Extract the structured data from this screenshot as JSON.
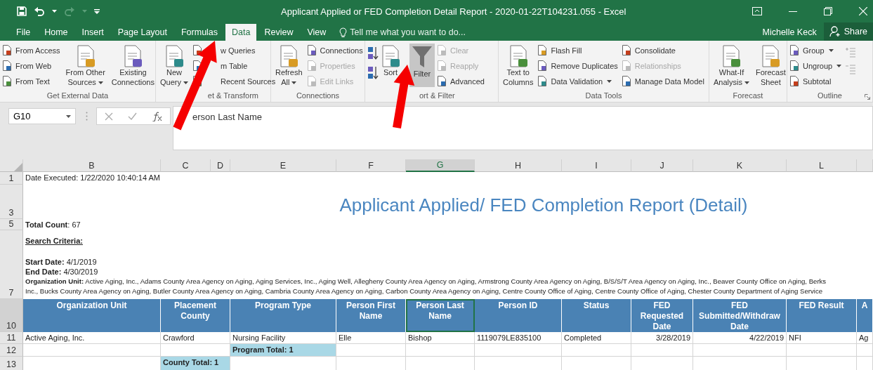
{
  "window": {
    "title": "Applicant Applied or FED Completion Detail Report - 2020-01-22T104231.055 - Excel",
    "user": "Michelle Keck",
    "share": "Share"
  },
  "tabs": [
    {
      "label": "File",
      "selected": false
    },
    {
      "label": "Home",
      "selected": false
    },
    {
      "label": "Insert",
      "selected": false
    },
    {
      "label": "Page Layout",
      "selected": false
    },
    {
      "label": "Formulas",
      "selected": false
    },
    {
      "label": "Data",
      "selected": true
    },
    {
      "label": "Review",
      "selected": false
    },
    {
      "label": "View",
      "selected": false
    }
  ],
  "tell_me": {
    "placeholder": "Tell me what you want to do..."
  },
  "ribbon_groups": [
    {
      "label": "Get External Data",
      "items": [
        {
          "kind": "stack",
          "items": [
            {
              "label": "From Access",
              "disabled": false
            },
            {
              "label": "From Web",
              "disabled": false
            },
            {
              "label": "From Text",
              "disabled": false
            }
          ]
        },
        {
          "kind": "large",
          "lines": [
            "From Other",
            "Sources"
          ],
          "dropdown": true,
          "selected": false
        },
        {
          "kind": "large",
          "lines": [
            "Existing",
            "Connections"
          ],
          "dropdown": false,
          "selected": false
        }
      ]
    },
    {
      "label": "et & Transform",
      "items": [
        {
          "kind": "large",
          "lines": [
            "New",
            "Query"
          ],
          "dropdown": true,
          "selected": false
        },
        {
          "kind": "stack",
          "items": [
            {
              "label": "w Queries",
              "disabled": false
            },
            {
              "label": "m Table",
              "disabled": false
            },
            {
              "label": "Recent Sources",
              "disabled": false
            }
          ]
        }
      ]
    },
    {
      "label": "Connections",
      "items": [
        {
          "kind": "large",
          "lines": [
            "Refresh",
            "All"
          ],
          "dropdown": true,
          "selected": false
        },
        {
          "kind": "stack",
          "items": [
            {
              "label": "Connections",
              "disabled": false
            },
            {
              "label": "Properties",
              "disabled": true
            },
            {
              "label": "Edit Links",
              "disabled": true
            }
          ]
        }
      ]
    },
    {
      "label": "ort & Filter",
      "items": [
        {
          "kind": "sort_icons"
        },
        {
          "kind": "large",
          "lines": [
            "Sort"
          ],
          "dropdown": false,
          "selected": false
        },
        {
          "kind": "large",
          "lines": [
            "Filter"
          ],
          "dropdown": false,
          "selected": true
        },
        {
          "kind": "stack",
          "items": [
            {
              "label": "Clear",
              "disabled": true
            },
            {
              "label": "Reapply",
              "disabled": true
            },
            {
              "label": "Advanced",
              "disabled": false
            }
          ]
        }
      ]
    },
    {
      "label": "Data Tools",
      "items": [
        {
          "kind": "large",
          "lines": [
            "Text to",
            "Columns"
          ],
          "dropdown": false,
          "selected": false
        },
        {
          "kind": "stack",
          "items": [
            {
              "label": "Flash Fill",
              "disabled": false
            },
            {
              "label": "Remove Duplicates",
              "disabled": false
            },
            {
              "label": "Data Validation",
              "disabled": false,
              "dropdown": true
            }
          ]
        },
        {
          "kind": "stack",
          "items": [
            {
              "label": "Consolidate",
              "disabled": false
            },
            {
              "label": "Relationships",
              "disabled": true
            },
            {
              "label": "Manage Data Model",
              "disabled": false
            }
          ]
        }
      ]
    },
    {
      "label": "Forecast",
      "items": [
        {
          "kind": "large",
          "lines": [
            "What-If",
            "Analysis"
          ],
          "dropdown": true,
          "selected": false
        },
        {
          "kind": "large",
          "lines": [
            "Forecast",
            "Sheet"
          ],
          "dropdown": false,
          "selected": false
        }
      ]
    },
    {
      "label": "Outline",
      "launcher": true,
      "items": [
        {
          "kind": "stack",
          "items": [
            {
              "label": "Group",
              "disabled": false,
              "dropdown": true
            },
            {
              "label": "Ungroup",
              "disabled": false,
              "dropdown": true
            },
            {
              "label": "Subtotal",
              "disabled": false
            }
          ]
        },
        {
          "kind": "detail_icons"
        }
      ]
    }
  ],
  "formula_bar": {
    "name_box": "G10",
    "formula": "erson Last Name"
  },
  "sheet": {
    "column_headers": [
      {
        "label": "B",
        "selected": false
      },
      {
        "label": "C",
        "selected": false
      },
      {
        "label": "D",
        "selected": false
      },
      {
        "label": "E",
        "selected": false
      },
      {
        "label": "F",
        "selected": false
      },
      {
        "label": "G",
        "selected": true
      },
      {
        "label": "H",
        "selected": false
      },
      {
        "label": "I",
        "selected": false
      },
      {
        "label": "J",
        "selected": false
      },
      {
        "label": "K",
        "selected": false
      },
      {
        "label": "L",
        "selected": false
      }
    ],
    "rows": [
      {
        "number": "1",
        "kind": "text",
        "text": "Date Executed: 1/22/2020 10:40:14 AM"
      },
      {
        "number": "3",
        "kind": "title",
        "text": "Applicant Applied/ FED Completion Report (Detail)"
      },
      {
        "number": "5",
        "kind": "text",
        "text": "**Total Count**: 67"
      },
      {
        "number": "7",
        "kind": "criteria",
        "heading": "Search Criteria:",
        "lines": [
          "**Start Date:** 4/1/2019",
          "**End Date:** 4/30/2019",
          "**Organization Unit:** Active Aging, Inc., Adams County Area Agency on Aging, Aging Services, Inc., Aging Well, Allegheny County Area Agency on Aging, Armstrong County Area Agency on Aging, B/S/S/T Area Agency on Aging, Inc., Beaver County Office on Aging, Berks",
          "Inc., Bucks County Area Agency on Aging, Butler County Area Agency on Aging, Cambria County Area Agency on Aging, Carbon County Area Agency on Aging, Centre County Office of Aging, Centre County Office of Aging, Chester County Department of Aging Service"
        ]
      },
      {
        "number": "10",
        "kind": "table_header",
        "cells": [
          {
            "text": "Organization Unit",
            "selected": false
          },
          {
            "text": "Placement County",
            "selected": false
          },
          {
            "text": "Program Type",
            "selected": false
          },
          {
            "text": "Person First Name",
            "selected": false
          },
          {
            "text": "Person Last Name",
            "selected": true
          },
          {
            "text": "Person ID",
            "selected": false
          },
          {
            "text": "Status",
            "selected": false
          },
          {
            "text": "FED Requested Date",
            "selected": false
          },
          {
            "text": "FED Submitted/Withdraw Date",
            "selected": false
          },
          {
            "text": "FED Result",
            "selected": false
          },
          {
            "text": "A",
            "selected": false
          }
        ]
      },
      {
        "number": "11",
        "kind": "data",
        "cells": [
          {
            "text": "Active Aging, Inc.",
            "kind": "text"
          },
          {
            "text": "Crawford",
            "kind": "text"
          },
          {
            "text": "Nursing Facility",
            "kind": "text"
          },
          {
            "text": "Elle",
            "kind": "text"
          },
          {
            "text": "Bishop",
            "kind": "text"
          },
          {
            "text": "1119079LE835100",
            "kind": "text"
          },
          {
            "text": "Completed",
            "kind": "text"
          },
          {
            "text": "3/28/2019",
            "kind": "number"
          },
          {
            "text": "4/22/2019",
            "kind": "number"
          },
          {
            "text": "NFI",
            "kind": "text"
          },
          {
            "text": "Ag",
            "kind": "text"
          }
        ]
      },
      {
        "number": "12",
        "kind": "data",
        "cells": [
          {
            "kind": "blank"
          },
          {
            "kind": "blank"
          },
          {
            "text": "Program Total: 1",
            "kind": "total"
          },
          {
            "kind": "blank"
          },
          {
            "kind": "blank"
          },
          {
            "kind": "blank"
          },
          {
            "kind": "blank"
          },
          {
            "kind": "blank"
          },
          {
            "kind": "blank"
          },
          {
            "kind": "blank"
          },
          {
            "kind": "blank"
          }
        ]
      },
      {
        "number": "13",
        "kind": "data",
        "cells": [
          {
            "kind": "blank"
          },
          {
            "text": "County Total: 1",
            "kind": "total"
          },
          {
            "kind": "blank"
          },
          {
            "kind": "blank"
          },
          {
            "kind": "blank"
          },
          {
            "kind": "blank"
          },
          {
            "kind": "blank"
          },
          {
            "kind": "blank"
          },
          {
            "kind": "blank"
          },
          {
            "kind": "blank"
          },
          {
            "kind": "blank"
          }
        ]
      }
    ]
  },
  "annotations": [
    {
      "kind": "arrow"
    },
    {
      "kind": "arrow"
    }
  ]
}
